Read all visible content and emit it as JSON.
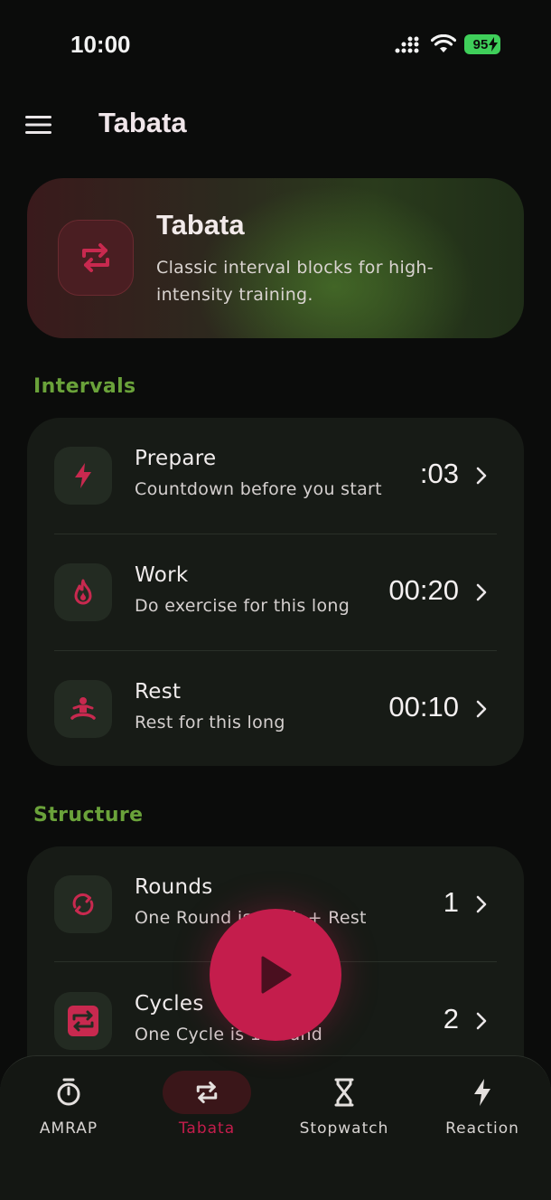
{
  "status_bar": {
    "time": "10:00",
    "battery": "95"
  },
  "app_bar": {
    "title": "Tabata"
  },
  "hero": {
    "title": "Tabata",
    "description": "Classic interval blocks for high-intensity training."
  },
  "sections": {
    "intervals": {
      "title": "Intervals",
      "rows": [
        {
          "title": "Prepare",
          "subtitle": "Countdown before you start",
          "value": ":03",
          "icon": "bolt-icon"
        },
        {
          "title": "Work",
          "subtitle": "Do exercise for this long",
          "value": "00:20",
          "icon": "flame-icon"
        },
        {
          "title": "Rest",
          "subtitle": "Rest for this long",
          "value": "00:10",
          "icon": "meditation-icon"
        }
      ]
    },
    "structure": {
      "title": "Structure",
      "rows": [
        {
          "title": "Rounds",
          "subtitle": "One Round is Work + Rest",
          "value": "1",
          "icon": "sync-icon"
        },
        {
          "title": "Cycles",
          "subtitle": "One Cycle is 1 Round",
          "value": "2",
          "icon": "repeat-box-icon"
        }
      ]
    }
  },
  "bottom_nav": {
    "items": [
      {
        "label": "AMRAP",
        "icon": "timer-icon",
        "active": false
      },
      {
        "label": "Tabata",
        "icon": "repeat-icon",
        "active": true
      },
      {
        "label": "Stopwatch",
        "icon": "hourglass-icon",
        "active": false
      },
      {
        "label": "Reaction",
        "icon": "bolt-icon",
        "active": false
      }
    ]
  },
  "colors": {
    "accent": "#c41d4c",
    "section_green": "#6aa23a",
    "background": "#0b0c0b",
    "card": "#171b16"
  }
}
